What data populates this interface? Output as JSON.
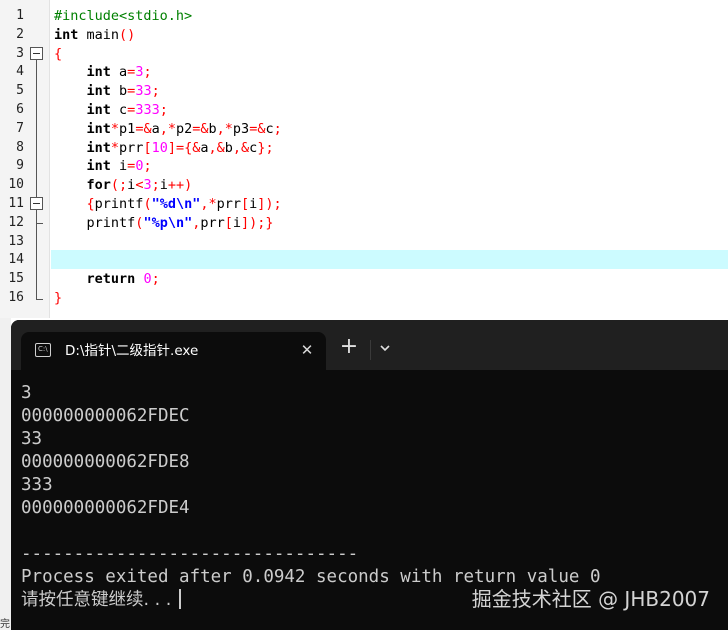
{
  "editor": {
    "line_numbers": [
      "1",
      "2",
      "3",
      "4",
      "5",
      "6",
      "7",
      "8",
      "9",
      "10",
      "11",
      "12",
      "13",
      "14",
      "15",
      "16"
    ],
    "lines": [
      {
        "segs": [
          {
            "t": "#include<stdio.h>",
            "c": "pp"
          }
        ]
      },
      {
        "segs": [
          {
            "t": "int",
            "c": "kw"
          },
          {
            "t": " main",
            "c": ""
          },
          {
            "t": "()",
            "c": "op"
          }
        ]
      },
      {
        "segs": [
          {
            "t": "{",
            "c": "br"
          }
        ]
      },
      {
        "segs": [
          {
            "t": "    ",
            "c": ""
          },
          {
            "t": "int",
            "c": "kw"
          },
          {
            "t": " a",
            "c": ""
          },
          {
            "t": "=",
            "c": "op"
          },
          {
            "t": "3",
            "c": "num"
          },
          {
            "t": ";",
            "c": "op"
          }
        ]
      },
      {
        "segs": [
          {
            "t": "    ",
            "c": ""
          },
          {
            "t": "int",
            "c": "kw"
          },
          {
            "t": " b",
            "c": ""
          },
          {
            "t": "=",
            "c": "op"
          },
          {
            "t": "33",
            "c": "num"
          },
          {
            "t": ";",
            "c": "op"
          }
        ]
      },
      {
        "segs": [
          {
            "t": "    ",
            "c": ""
          },
          {
            "t": "int",
            "c": "kw"
          },
          {
            "t": " c",
            "c": ""
          },
          {
            "t": "=",
            "c": "op"
          },
          {
            "t": "333",
            "c": "num"
          },
          {
            "t": ";",
            "c": "op"
          }
        ]
      },
      {
        "segs": [
          {
            "t": "    ",
            "c": ""
          },
          {
            "t": "int",
            "c": "kw"
          },
          {
            "t": "*",
            "c": "op"
          },
          {
            "t": "p1",
            "c": ""
          },
          {
            "t": "=&",
            "c": "op"
          },
          {
            "t": "a",
            "c": ""
          },
          {
            "t": ",*",
            "c": "op"
          },
          {
            "t": "p2",
            "c": ""
          },
          {
            "t": "=&",
            "c": "op"
          },
          {
            "t": "b",
            "c": ""
          },
          {
            "t": ",*",
            "c": "op"
          },
          {
            "t": "p3",
            "c": ""
          },
          {
            "t": "=&",
            "c": "op"
          },
          {
            "t": "c",
            "c": ""
          },
          {
            "t": ";",
            "c": "op"
          }
        ]
      },
      {
        "segs": [
          {
            "t": "    ",
            "c": ""
          },
          {
            "t": "int",
            "c": "kw"
          },
          {
            "t": "*",
            "c": "op"
          },
          {
            "t": "prr",
            "c": ""
          },
          {
            "t": "[",
            "c": "op"
          },
          {
            "t": "10",
            "c": "num"
          },
          {
            "t": "]={&",
            "c": "op"
          },
          {
            "t": "a",
            "c": ""
          },
          {
            "t": ",&",
            "c": "op"
          },
          {
            "t": "b",
            "c": ""
          },
          {
            "t": ",&",
            "c": "op"
          },
          {
            "t": "c",
            "c": ""
          },
          {
            "t": "};",
            "c": "op"
          }
        ]
      },
      {
        "segs": [
          {
            "t": "    ",
            "c": ""
          },
          {
            "t": "int",
            "c": "kw"
          },
          {
            "t": " i",
            "c": ""
          },
          {
            "t": "=",
            "c": "op"
          },
          {
            "t": "0",
            "c": "num"
          },
          {
            "t": ";",
            "c": "op"
          }
        ]
      },
      {
        "segs": [
          {
            "t": "    ",
            "c": ""
          },
          {
            "t": "for",
            "c": "kw"
          },
          {
            "t": "(;",
            "c": "op"
          },
          {
            "t": "i",
            "c": ""
          },
          {
            "t": "<",
            "c": "op"
          },
          {
            "t": "3",
            "c": "num"
          },
          {
            "t": ";",
            "c": "op"
          },
          {
            "t": "i",
            "c": ""
          },
          {
            "t": "++)",
            "c": "op"
          }
        ]
      },
      {
        "segs": [
          {
            "t": "    ",
            "c": ""
          },
          {
            "t": "{",
            "c": "br"
          },
          {
            "t": "printf",
            "c": ""
          },
          {
            "t": "(",
            "c": "op"
          },
          {
            "t": "\"%d\\n\"",
            "c": "str"
          },
          {
            "t": ",*",
            "c": "op"
          },
          {
            "t": "prr",
            "c": ""
          },
          {
            "t": "[",
            "c": "op"
          },
          {
            "t": "i",
            "c": ""
          },
          {
            "t": "]);",
            "c": "op"
          }
        ]
      },
      {
        "segs": [
          {
            "t": "    ",
            "c": ""
          },
          {
            "t": "printf",
            "c": ""
          },
          {
            "t": "(",
            "c": "op"
          },
          {
            "t": "\"%p\\n\"",
            "c": "str"
          },
          {
            "t": ",",
            "c": "op"
          },
          {
            "t": "prr",
            "c": ""
          },
          {
            "t": "[",
            "c": "op"
          },
          {
            "t": "i",
            "c": ""
          },
          {
            "t": "]);",
            "c": "op"
          },
          {
            "t": "}",
            "c": "br"
          }
        ]
      },
      {
        "segs": []
      },
      {
        "segs": []
      },
      {
        "segs": [
          {
            "t": "    ",
            "c": ""
          },
          {
            "t": "return",
            "c": "kw"
          },
          {
            "t": " ",
            "c": ""
          },
          {
            "t": "0",
            "c": "num"
          },
          {
            "t": ";",
            "c": "op"
          }
        ]
      },
      {
        "segs": [
          {
            "t": "}",
            "c": "br"
          }
        ]
      }
    ]
  },
  "terminal": {
    "tab_title": "D:\\指针\\二级指针.exe",
    "tab_icon_text": "C:\\",
    "close_glyph": "✕",
    "new_tab_glyph": "+",
    "output": [
      "3",
      "000000000062FDEC",
      "33",
      "000000000062FDE8",
      "333",
      "000000000062FDE4",
      "",
      "--------------------------------",
      "Process exited after 0.0942 seconds with return value 0"
    ],
    "prompt_line": "请按任意键继续. . .",
    "watermark": "掘金技术社区 @ JHB2007"
  },
  "status_stub": "完",
  "colors": {
    "highlight_line": "#ccfbff",
    "terminal_bg": "#0c0c0c",
    "titlebar_bg": "#202020"
  }
}
